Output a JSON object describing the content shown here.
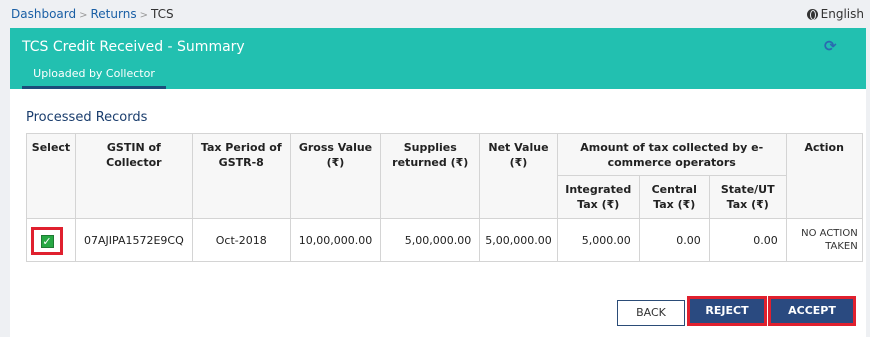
{
  "breadcrumb": {
    "items": [
      "Dashboard",
      "Returns",
      "TCS"
    ]
  },
  "language": "English",
  "header": {
    "title": "TCS Credit Received - Summary",
    "tab": "Uploaded by Collector"
  },
  "section_title": "Processed Records",
  "table": {
    "headers": {
      "select": "Select",
      "gstin": "GSTIN of Collector",
      "tax_period": "Tax Period of GSTR-8",
      "gross_value": "Gross Value (₹)",
      "supplies_returned": "Supplies returned (₹)",
      "net_value": "Net Value (₹)",
      "amount_group": "Amount of tax collected by e-commerce operators",
      "integrated": "Integrated Tax (₹)",
      "central": "Central Tax (₹)",
      "state": "State/UT Tax (₹)",
      "action": "Action"
    },
    "rows": [
      {
        "selected": true,
        "gstin": "07AJIPA1572E9CQ",
        "tax_period": "Oct-2018",
        "gross_value": "10,00,000.00",
        "supplies_returned": "5,00,000.00",
        "net_value": "5,00,000.00",
        "integrated": "5,000.00",
        "central": "0.00",
        "state": "0.00",
        "action_line1": "NO ACTION",
        "action_line2": "TAKEN"
      }
    ]
  },
  "buttons": {
    "back": "BACK",
    "reject": "REJECT",
    "accept": "ACCEPT"
  },
  "colors": {
    "header": "#22c0b0",
    "primary_button": "#2a4a80",
    "highlight": "#e0202e",
    "checkbox": "#27a844"
  }
}
